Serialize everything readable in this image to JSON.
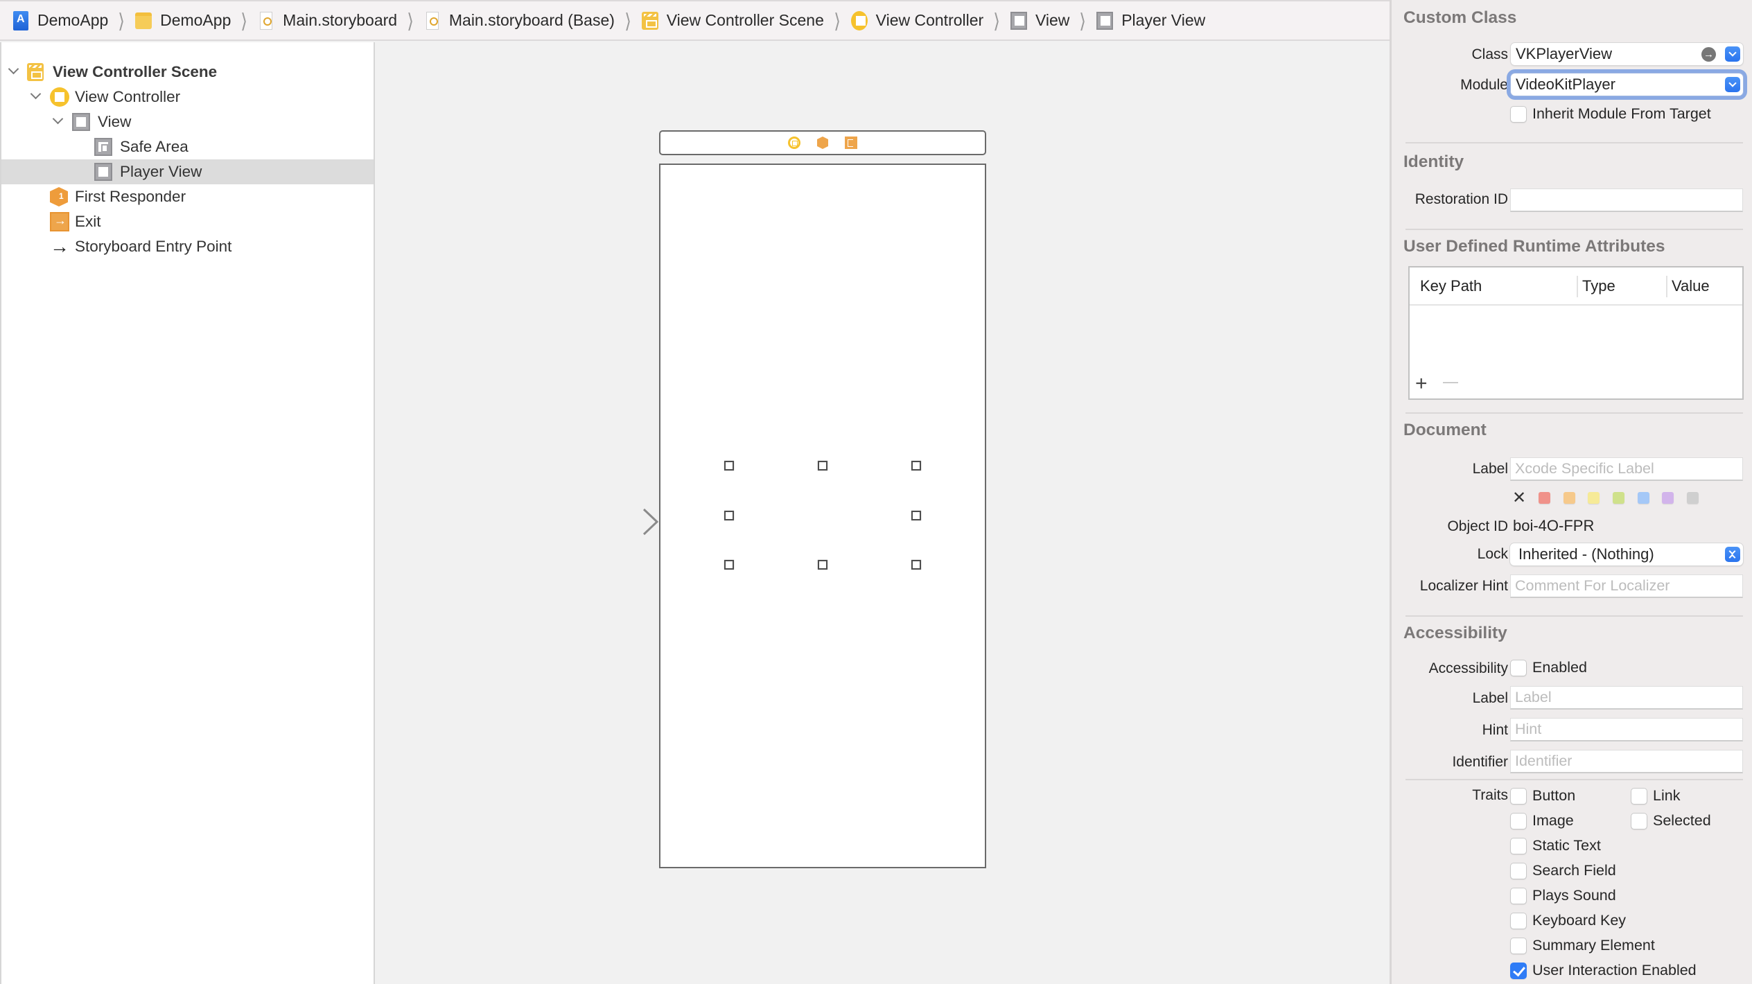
{
  "breadcrumb": [
    {
      "label": "DemoApp",
      "icon": "xcode-project-icon"
    },
    {
      "label": "DemoApp",
      "icon": "folder-icon"
    },
    {
      "label": "Main.storyboard",
      "icon": "storyboard-file-icon"
    },
    {
      "label": "Main.storyboard (Base)",
      "icon": "storyboard-file-icon"
    },
    {
      "label": "View Controller Scene",
      "icon": "scene-icon"
    },
    {
      "label": "View Controller",
      "icon": "view-controller-icon"
    },
    {
      "label": "View",
      "icon": "view-icon"
    },
    {
      "label": "Player View",
      "icon": "view-icon"
    }
  ],
  "outline": {
    "items": [
      {
        "label": "View Controller Scene",
        "icon": "scene-icon",
        "expanded": true,
        "level": 0
      },
      {
        "label": "View Controller",
        "icon": "view-controller-icon",
        "expanded": true,
        "level": 1
      },
      {
        "label": "View",
        "icon": "view-icon",
        "expanded": true,
        "level": 2
      },
      {
        "label": "Safe Area",
        "icon": "safe-area-icon",
        "level": 3
      },
      {
        "label": "Player View",
        "icon": "view-icon",
        "level": 3,
        "selected": true
      },
      {
        "label": "First Responder",
        "icon": "first-responder-icon",
        "level": 1
      },
      {
        "label": "Exit",
        "icon": "exit-icon",
        "level": 1
      },
      {
        "label": "Storyboard Entry Point",
        "icon": "entry-arrow-icon",
        "level": 1
      }
    ]
  },
  "canvas": {
    "dock_icons": [
      "view-controller-icon",
      "first-responder-icon",
      "exit-icon"
    ],
    "selected_view": "Player View"
  },
  "inspector": {
    "custom_class": {
      "title": "Custom Class",
      "class_label": "Class",
      "class_value": "VKPlayerView",
      "module_label": "Module",
      "module_value": "VideoKitPlayer",
      "inherit_label": "Inherit Module From Target",
      "inherit_checked": false
    },
    "identity": {
      "title": "Identity",
      "restoration_label": "Restoration ID",
      "restoration_value": ""
    },
    "runtime_attributes": {
      "title": "User Defined Runtime Attributes",
      "columns": [
        "Key Path",
        "Type",
        "Value"
      ],
      "rows": [],
      "add_label": "+",
      "remove_label": "—"
    },
    "document": {
      "title": "Document",
      "label_label": "Label",
      "label_placeholder": "Xcode Specific Label",
      "clear_label": "✕",
      "colors": [
        "#f0928a",
        "#f6c98b",
        "#f6ea97",
        "#cfe18b",
        "#a5c8f7",
        "#d2b4eb",
        "#cfcfcf"
      ],
      "object_id_label": "Object ID",
      "object_id": "boi-4O-FPR",
      "lock_label": "Lock",
      "lock_value": "Inherited - (Nothing)",
      "localizer_label": "Localizer Hint",
      "localizer_placeholder": "Comment For Localizer"
    },
    "accessibility": {
      "title": "Accessibility",
      "accessibility_label": "Accessibility",
      "enabled_label": "Enabled",
      "enabled_checked": false,
      "label_label": "Label",
      "label_placeholder": "Label",
      "hint_label": "Hint",
      "hint_placeholder": "Hint",
      "identifier_label": "Identifier",
      "identifier_placeholder": "Identifier",
      "traits_label": "Traits",
      "traits": [
        {
          "label": "Button",
          "checked": false
        },
        {
          "label": "Link",
          "checked": false
        },
        {
          "label": "Image",
          "checked": false
        },
        {
          "label": "Selected",
          "checked": false
        },
        {
          "label": "Static Text",
          "checked": false
        },
        {
          "label": "Search Field",
          "checked": false
        },
        {
          "label": "Plays Sound",
          "checked": false
        },
        {
          "label": "Keyboard Key",
          "checked": false
        },
        {
          "label": "Summary Element",
          "checked": false
        },
        {
          "label": "User Interaction Enabled",
          "checked": true
        }
      ]
    }
  }
}
